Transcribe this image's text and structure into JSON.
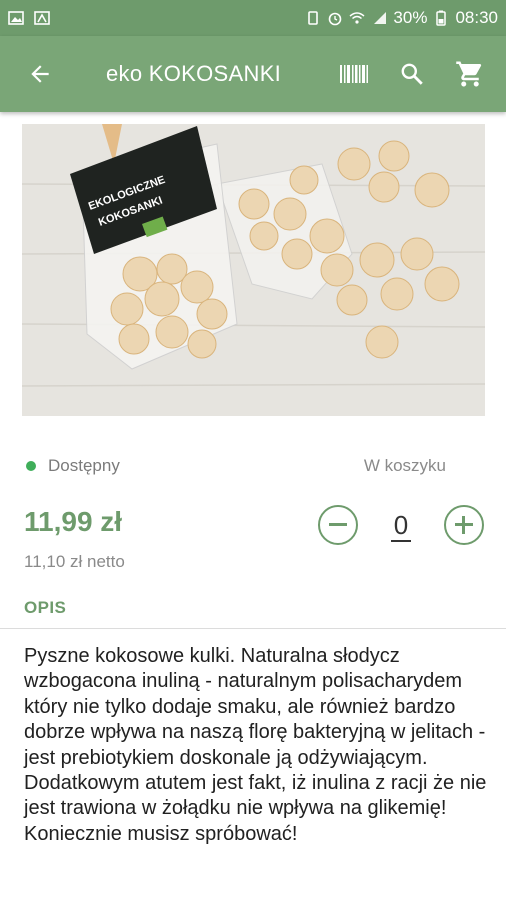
{
  "statusbar": {
    "battery_percent": "30%",
    "time": "08:30",
    "icons": [
      "image-icon",
      "flag-icon",
      "vibrate-icon",
      "alarm-icon",
      "wifi-icon",
      "signal-icon",
      "battery-icon"
    ]
  },
  "appbar": {
    "title": "eko KOKOSANKI",
    "icons": [
      "back-arrow-icon",
      "barcode-icon",
      "search-icon",
      "cart-icon"
    ]
  },
  "product": {
    "availability": "Dostępny",
    "in_cart_label": "W koszyku",
    "price": "11,99 zł",
    "price_netto": "11,10 zł netto",
    "quantity": "0",
    "photo_label_lines": [
      "EKOLOGICZNE",
      "KOKOSANKI"
    ]
  },
  "description": {
    "title": "OPIS",
    "text": "Pyszne kokosowe kulki. Naturalna słodycz wzbogacona inuliną - naturalnym polisacharydem który nie tylko dodaje smaku, ale również bardzo dobrze wpływa na naszą florę bakteryjną w jelitach - jest prebiotykiem doskonale ją odżywiającym. Dodatkowym atutem jest fakt, iż inulina z racji że nie jest trawiona w żołądku nie wpływa na glikemię! Koniecznie musisz spróbować!"
  },
  "colors": {
    "appbar": "#7aa677",
    "statusbar": "#6e9b6c",
    "accent": "#6e9b6c",
    "available_dot": "#3fae5a"
  }
}
